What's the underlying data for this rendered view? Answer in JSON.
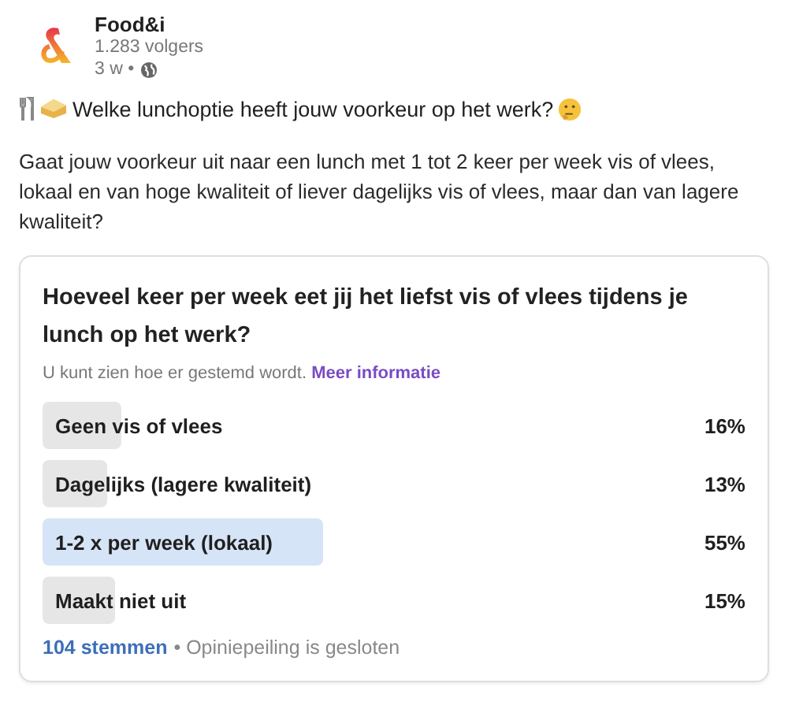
{
  "author": {
    "name": "Food&i",
    "followers": "1.283 volgers",
    "age": "3 w •"
  },
  "headline": "Welke lunchoptie heeft jouw voorkeur op het werk?",
  "body": "Gaat jouw voorkeur uit naar een lunch met 1 tot 2 keer per week vis of vlees, lokaal en van hoge kwaliteit of liever dagelijks vis of vlees, maar dan van lagere kwaliteit?",
  "poll": {
    "question": "Hoeveel keer per week eet jij het liefst vis of vlees tijdens je lunch op het werk?",
    "note": "U kunt zien hoe er gestemd wordt.",
    "link": "Meer informatie",
    "options": [
      {
        "label": "Geen vis of vlees",
        "percent": "16%",
        "level": 0.13,
        "selected": false
      },
      {
        "label": "Dagelijks (lagere kwaliteit)",
        "percent": "13%",
        "level": 0.105,
        "selected": false
      },
      {
        "label": "1-2 x per week (lokaal)",
        "percent": "55%",
        "level": 0.46,
        "selected": true
      },
      {
        "label": "Maakt niet uit",
        "percent": "15%",
        "level": 0.12,
        "selected": false
      }
    ],
    "votes": "104 stemmen",
    "status": "• Opiniepeiling is gesloten"
  }
}
